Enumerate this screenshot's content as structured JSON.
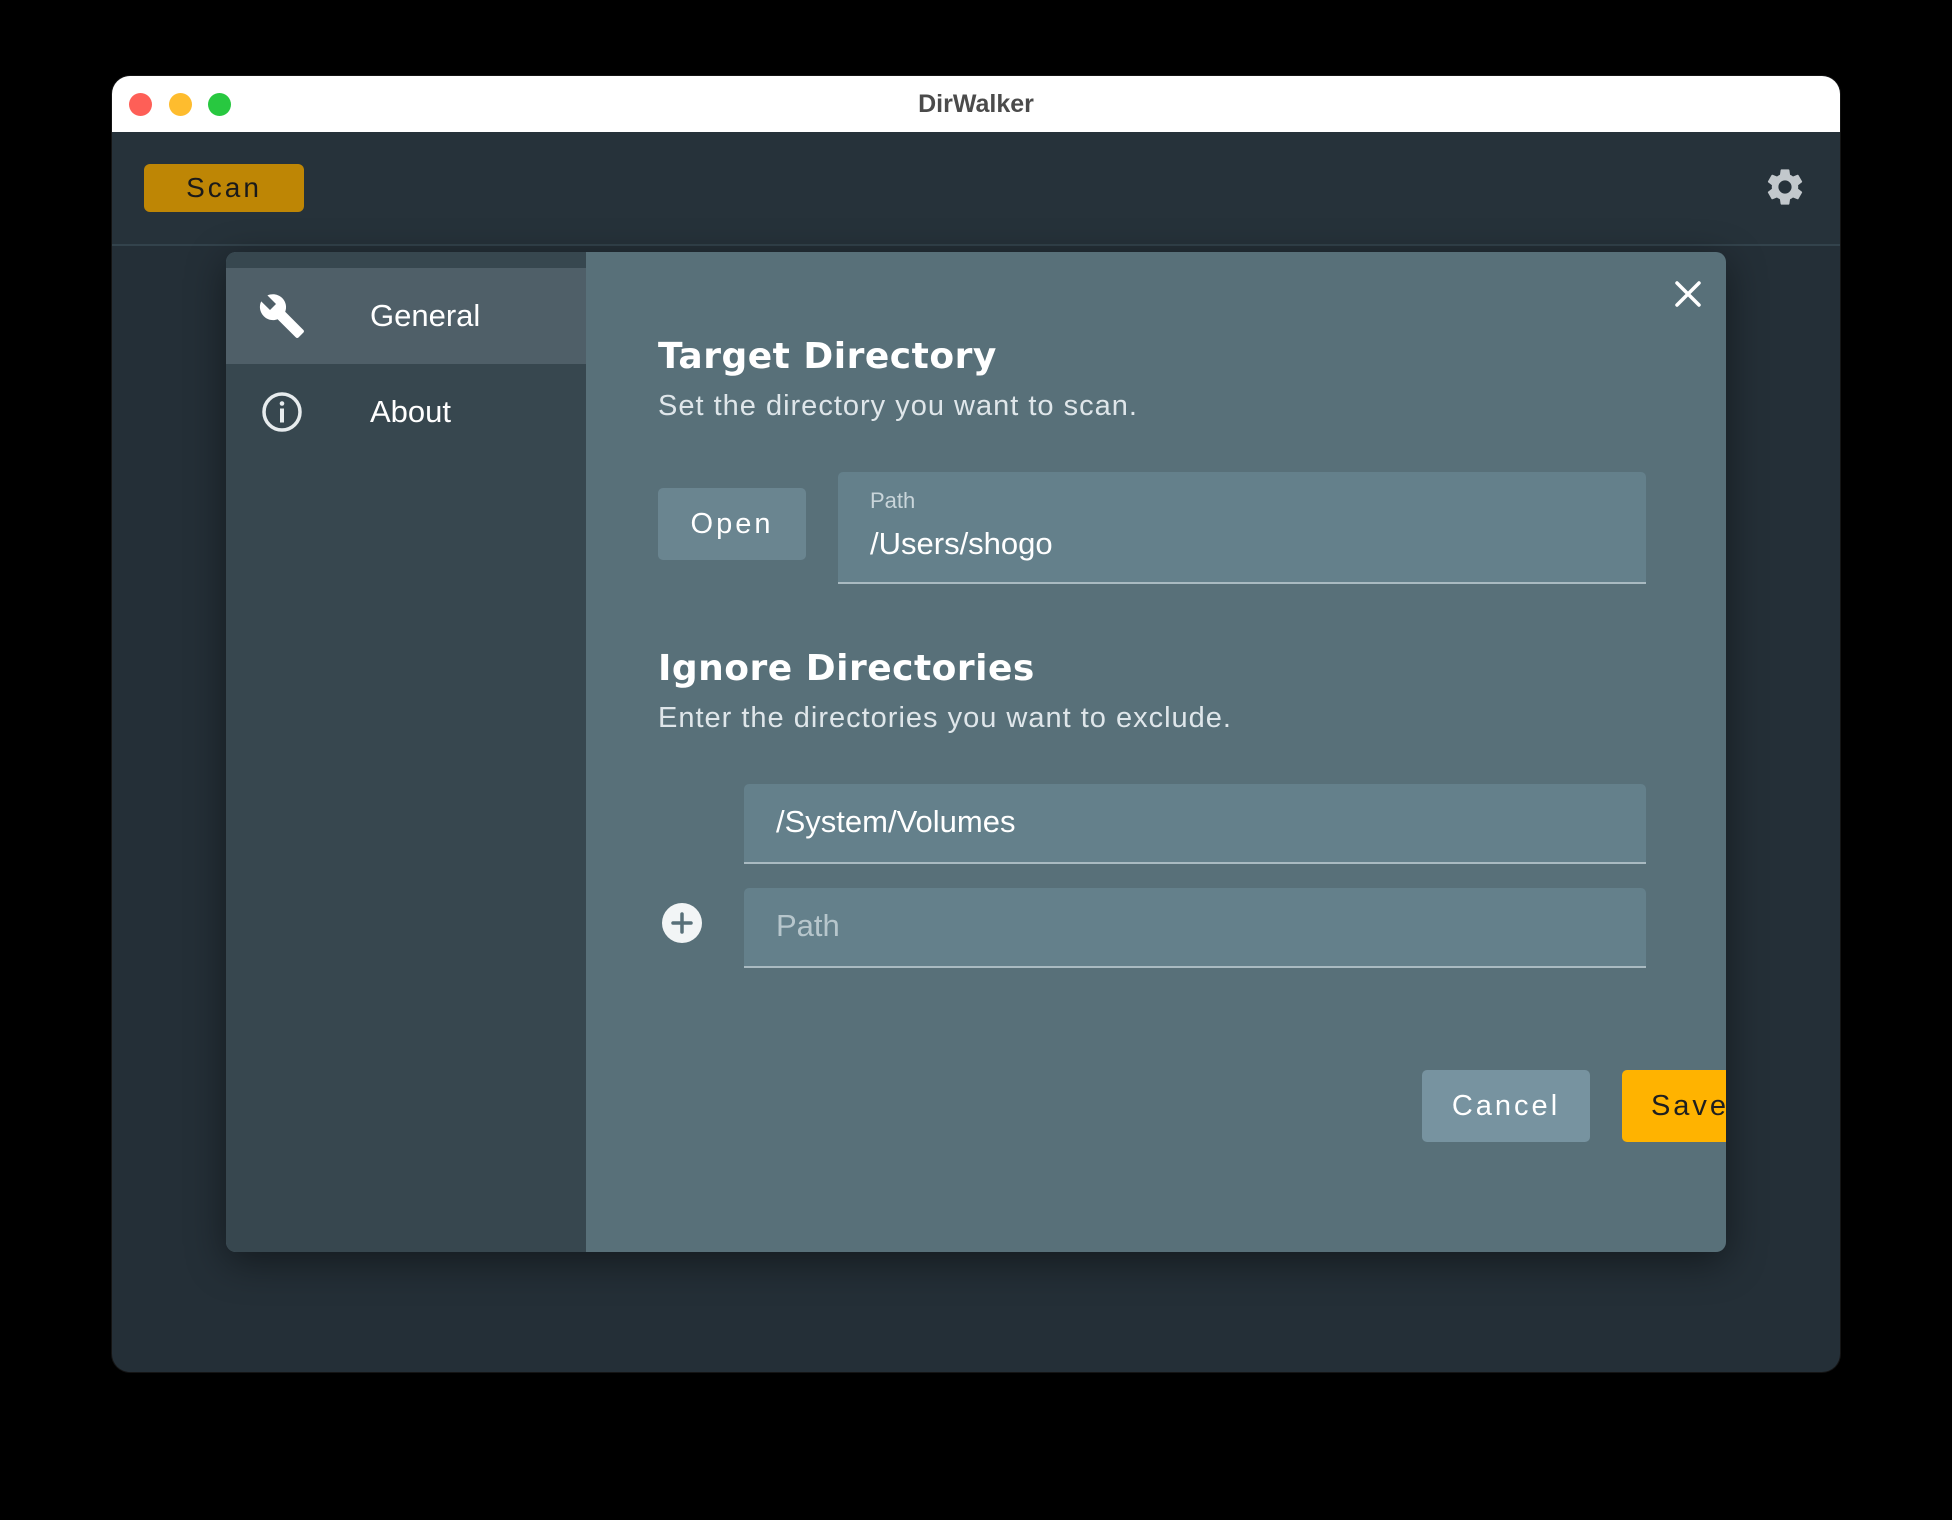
{
  "window": {
    "title": "DirWalker"
  },
  "toolbar": {
    "scan_label": "Scan",
    "settings_icon": "gear-icon"
  },
  "dialog": {
    "sidebar": {
      "items": [
        {
          "label": "General",
          "icon": "wrench-icon",
          "active": true
        },
        {
          "label": "About",
          "icon": "info-icon",
          "active": false
        }
      ]
    },
    "close_icon": "close-icon",
    "target": {
      "title": "Target Directory",
      "subtitle": "Set the directory you want to scan.",
      "open_label": "Open",
      "path_label": "Path",
      "path_value": "/Users/shogo"
    },
    "ignore": {
      "title": "Ignore Directories",
      "subtitle": "Enter the directories you want to exclude.",
      "entries": [
        "/System/Volumes"
      ],
      "new_placeholder": "Path",
      "add_icon": "plus-circle-icon"
    },
    "actions": {
      "cancel_label": "Cancel",
      "save_label": "Save"
    }
  },
  "colors": {
    "accent": "#ffb300",
    "scan_button": "#be8605",
    "dialog_bg": "#587079",
    "sidebar_bg": "#37474f"
  }
}
